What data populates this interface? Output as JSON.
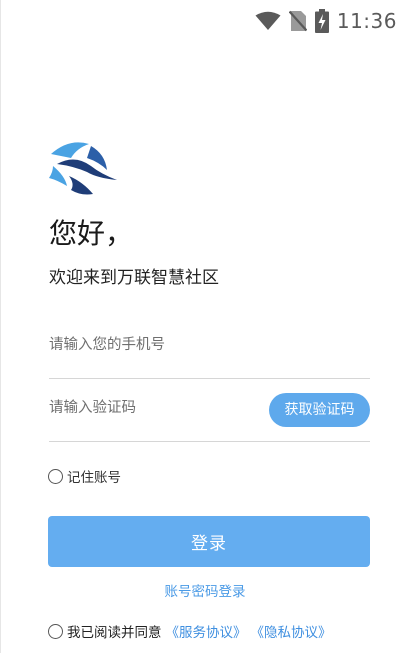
{
  "status_bar": {
    "time": "11:36",
    "icons": [
      "wifi-icon",
      "no-sim-icon",
      "battery-charging-icon"
    ]
  },
  "app": {
    "logo_icon": "wanlian-logo-icon",
    "greeting": "您好，",
    "welcome": "欢迎来到万联智慧社区"
  },
  "form": {
    "phone_placeholder": "请输入您的手机号",
    "code_placeholder": "请输入验证码",
    "get_code_label": "获取验证码",
    "remember_label": "记住账号",
    "login_label": "登录",
    "password_login_label": "账号密码登录"
  },
  "agreement": {
    "prefix": "我已阅读并同意",
    "service_link": "《服务协议》",
    "privacy_link": "《隐私协议》"
  },
  "colors": {
    "accent": "#64adf0",
    "link": "#3f8fe0",
    "logo_dark": "#1f3d78",
    "logo_light": "#4aa3e3"
  }
}
